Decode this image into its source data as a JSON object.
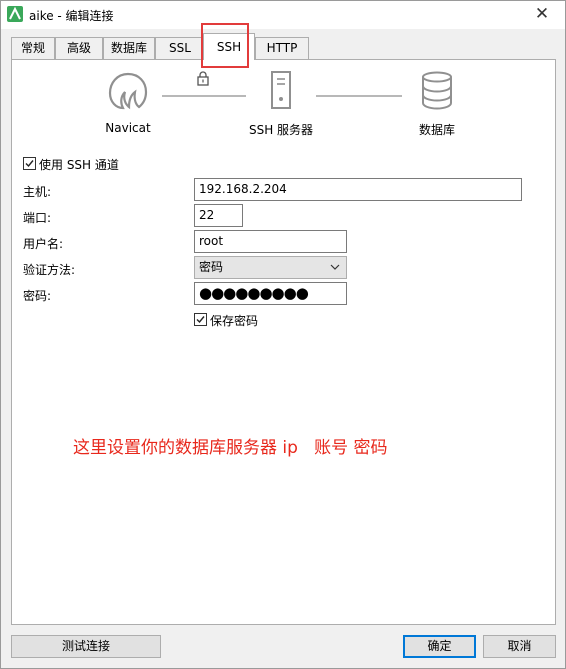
{
  "window": {
    "title": "aike - 编辑连接",
    "close_symbol": "✕"
  },
  "tabs": [
    {
      "label": "常规",
      "active": false
    },
    {
      "label": "高级",
      "active": false
    },
    {
      "label": "数据库",
      "active": false
    },
    {
      "label": "SSL",
      "active": false
    },
    {
      "label": "SSH",
      "active": true
    },
    {
      "label": "HTTP",
      "active": false
    }
  ],
  "diagram": {
    "navicat_label": "Navicat",
    "ssh_server_label": "SSH 服务器",
    "database_label": "数据库"
  },
  "form": {
    "use_ssh_label": "使用 SSH 通道",
    "use_ssh_checked": true,
    "host_label": "主机:",
    "host_value": "192.168.2.204",
    "port_label": "端口:",
    "port_value": "22",
    "username_label": "用户名:",
    "username_value": "root",
    "auth_label": "验证方法:",
    "auth_value": "密码",
    "password_label": "密码:",
    "password_mask": "●●●●●●●●●",
    "save_password_label": "保存密码",
    "save_password_checked": true
  },
  "annotation": {
    "note": "这里设置你的数据库服务器 ip   账号 密码",
    "color": "#e8281c"
  },
  "buttons": {
    "test": "测试连接",
    "ok": "确定",
    "cancel": "取消"
  },
  "colors": {
    "highlight_border": "#e23b3b",
    "primary_border": "#0078d7",
    "app_icon": "#3aa85a"
  }
}
